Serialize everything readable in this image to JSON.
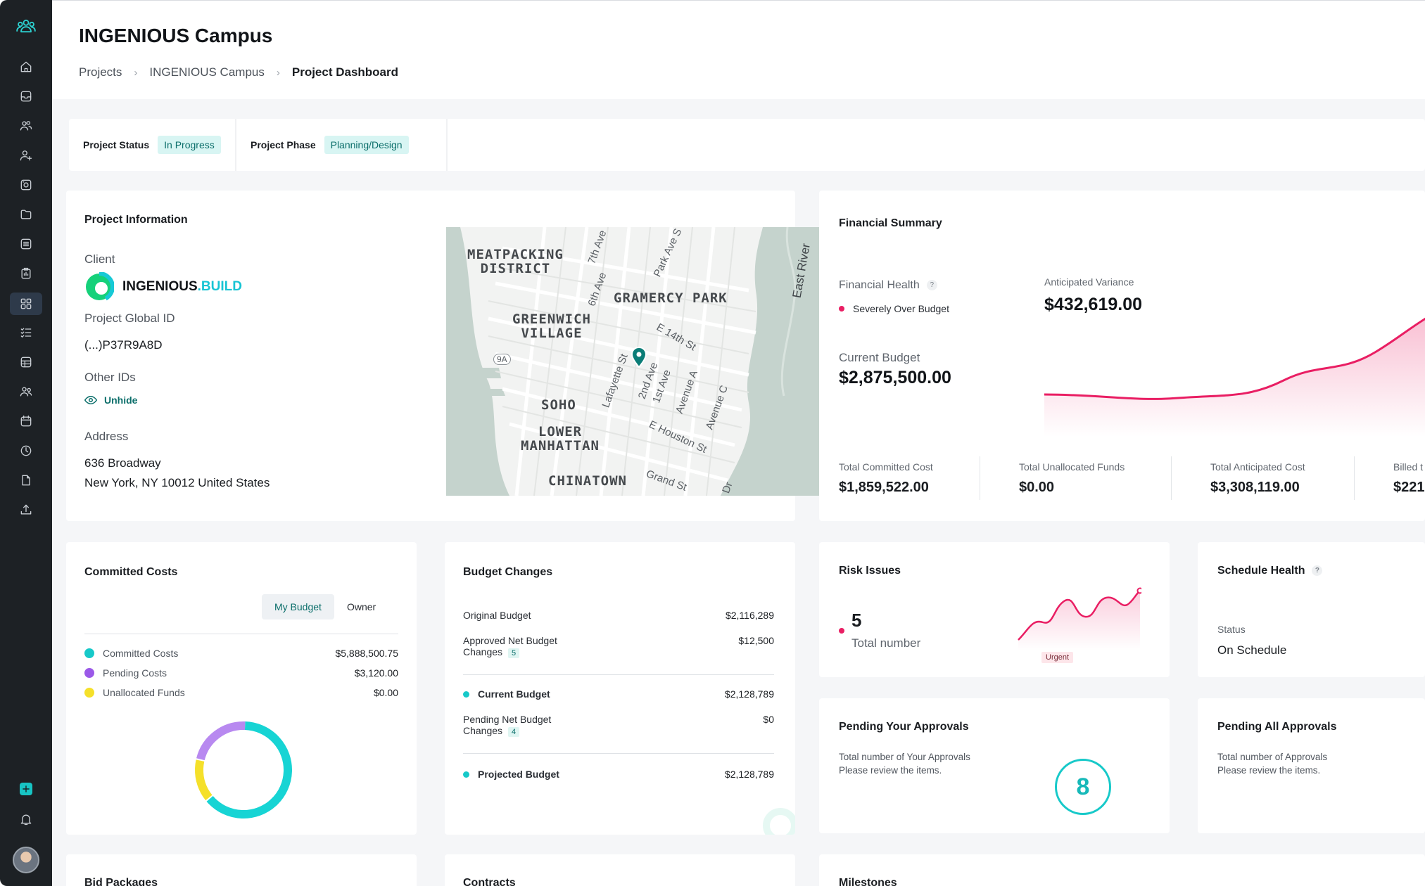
{
  "header": {
    "title": "INGENIOUS Campus",
    "breadcrumb": [
      "Projects",
      "INGENIOUS Campus",
      "Project Dashboard"
    ]
  },
  "sidebar": {
    "icons": [
      "team-logo-icon",
      "home-icon",
      "inbox-icon",
      "users-icon",
      "user-add-icon",
      "gallery-icon",
      "folder-icon",
      "list-icon",
      "report-icon",
      "dashboard-icon",
      "checklist-icon",
      "table-icon",
      "people-icon",
      "calendar-icon",
      "clock-icon",
      "document-icon",
      "upload-icon",
      "add-icon",
      "bell-icon"
    ],
    "active": "dashboard-icon"
  },
  "status": {
    "project_status_label": "Project Status",
    "project_status_value": "In Progress",
    "project_phase_label": "Project Phase",
    "project_phase_value": "Planning/Design"
  },
  "project_info": {
    "title": "Project Information",
    "client_label": "Client",
    "client_name_part1": "INGENIOUS",
    "client_name_part2": ".BUILD",
    "global_id_label": "Project Global ID",
    "global_id_value": "(...)P37R9A8D",
    "other_ids_label": "Other IDs",
    "unhide_label": "Unhide",
    "address_label": "Address",
    "address_line1": "636 Broadway",
    "address_line2": "New York, NY 10012 United States",
    "map": {
      "areas": [
        "MEATPACKING\nDISTRICT",
        "GRAMERCY PARK",
        "GREENWICH\nVILLAGE",
        "SOHO",
        "LOWER\nMANHATTAN",
        "CHINATOWN"
      ],
      "streets": [
        "7th Ave",
        "Park Ave S",
        "6th Ave",
        "E 14th St",
        "Lafayette St",
        "2nd Ave",
        "1st Ave",
        "Avenue A",
        "Avenue C",
        "E Houston St",
        "Grand St",
        "East River",
        "9A",
        "Dr"
      ]
    }
  },
  "financial": {
    "title": "Financial Summary",
    "health_label": "Financial Health",
    "health_value": "Severely Over Budget",
    "variance_label": "Anticipated Variance",
    "variance_value": "$432,619.00",
    "current_budget_label": "Current Budget",
    "current_budget_value": "$2,875,500.00",
    "totals": [
      {
        "label": "Total Committed Cost",
        "value": "$1,859,522.00"
      },
      {
        "label": "Total Unallocated Funds",
        "value": "$0.00"
      },
      {
        "label": "Total Anticipated Cost",
        "value": "$3,308,119.00"
      },
      {
        "label": "Billed t",
        "value": "$221,"
      }
    ],
    "colors": {
      "alert": "#e91e63"
    }
  },
  "committed": {
    "title": "Committed Costs",
    "tabs": [
      "My Budget",
      "Owner"
    ],
    "items": [
      {
        "label": "Committed Costs",
        "value": "$5,888,500.75",
        "color": "#17c9c9"
      },
      {
        "label": "Pending Costs",
        "value": "$3,120.00",
        "color": "#9b59e8"
      },
      {
        "label": "Unallocated Funds",
        "value": "$0.00",
        "color": "#f5e02a"
      }
    ]
  },
  "budget_changes": {
    "title": "Budget Changes",
    "original_label": "Original Budget",
    "original_value": "$2,116,289",
    "approved_label_1": "Approved Net Budget",
    "approved_label_2": "Changes",
    "approved_count": "5",
    "approved_value": "$12,500",
    "current_label": "Current Budget",
    "current_value": "$2,128,789",
    "pending_label_1": "Pending Net Budget",
    "pending_label_2": "Changes",
    "pending_count": "4",
    "pending_value": "$0",
    "projected_label": "Projected Budget",
    "projected_value": "$2,128,789"
  },
  "risk": {
    "title": "Risk Issues",
    "count": "5",
    "count_label": "Total number",
    "badge": "Urgent"
  },
  "schedule": {
    "title": "Schedule Health",
    "status_label": "Status",
    "status_value": "On Schedule"
  },
  "pending_your": {
    "title": "Pending Your Approvals",
    "line1": "Total number of Your Approvals",
    "line2": "Please review the items.",
    "count": "8"
  },
  "pending_all": {
    "title": "Pending All Approvals",
    "line1": "Total number of Approvals",
    "line2": "Please review the items."
  },
  "bottom": {
    "bid_packages": "Bid Packages",
    "contracts": "Contracts",
    "milestones": "Milestones"
  }
}
